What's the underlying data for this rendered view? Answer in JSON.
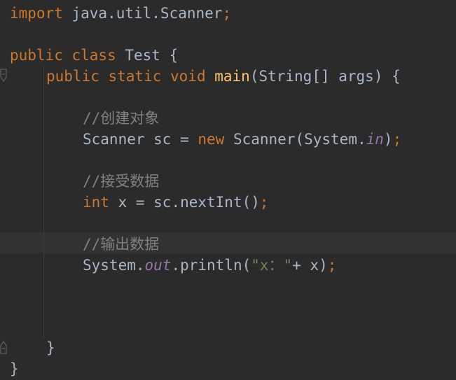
{
  "code": {
    "line1": {
      "kw_import": "import",
      "text_package": " java.util.Scanner",
      "semi": ";"
    },
    "line2": {
      "kw_public": "public",
      "kw_class": " class",
      "text_name": " Test {"
    },
    "line3": {
      "kw_public": "public",
      "kw_static": " static",
      "kw_void": " void",
      "fn_main": " main",
      "text_params": "(String[] args) {"
    },
    "comment1": "//创建对象",
    "line4": {
      "text_type": "Scanner sc = ",
      "kw_new": "new",
      "text_ctor": " Scanner(System.",
      "field_in": "in",
      "text_close": ")",
      "semi": ";"
    },
    "comment2": "//接受数据",
    "line5": {
      "kw_int": "int",
      "text_expr": " x = sc.nextInt()",
      "semi": ";"
    },
    "comment3": "//输出数据",
    "line6": {
      "text_system": "System.",
      "field_out": "out",
      "text_call": ".println(",
      "str_literal": "\"x：\"",
      "text_rest": "+ x)",
      "semi": ";"
    },
    "line7": {
      "text_brace": "}"
    },
    "line8": {
      "text_brace": "}"
    }
  },
  "colors": {
    "background": "#2b2b2b",
    "keyword": "#cc7832",
    "text": "#a9b7c6",
    "method": "#ffc66d",
    "field": "#9876aa",
    "comment": "#808080",
    "string": "#6a8759"
  }
}
